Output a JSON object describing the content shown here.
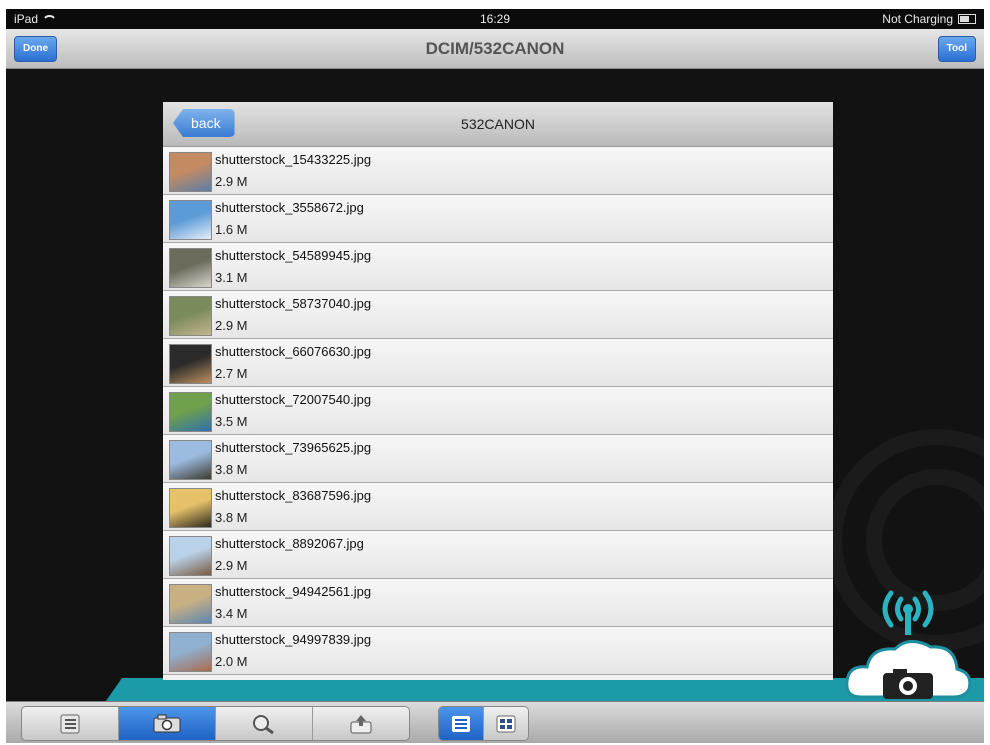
{
  "status_bar": {
    "device": "iPad",
    "time": "16:29",
    "battery_text": "Not Charging"
  },
  "nav_bar": {
    "title": "DCIM/532CANON",
    "left_button": "Done",
    "right_button": "Tool"
  },
  "panel": {
    "back_label": "back",
    "title": "532CANON"
  },
  "files": [
    {
      "name": "shutterstock_15433225.jpg",
      "size": "2.9 M"
    },
    {
      "name": "shutterstock_3558672.jpg",
      "size": "1.6 M"
    },
    {
      "name": "shutterstock_54589945.jpg",
      "size": "3.1 M"
    },
    {
      "name": "shutterstock_58737040.jpg",
      "size": "2.9 M"
    },
    {
      "name": "shutterstock_66076630.jpg",
      "size": "2.7 M"
    },
    {
      "name": "shutterstock_72007540.jpg",
      "size": "3.5 M"
    },
    {
      "name": "shutterstock_73965625.jpg",
      "size": "3.8 M"
    },
    {
      "name": "shutterstock_83687596.jpg",
      "size": "3.8 M"
    },
    {
      "name": "shutterstock_8892067.jpg",
      "size": "2.9 M"
    },
    {
      "name": "shutterstock_94942561.jpg",
      "size": "3.4 M"
    },
    {
      "name": "shutterstock_94997839.jpg",
      "size": "2.0 M"
    }
  ],
  "toolbar": {
    "tabs": [
      "list-icon",
      "camera-icon",
      "search-icon",
      "share-icon"
    ],
    "selected_tab": 1,
    "view_modes": [
      "list-view-icon",
      "grid-view-icon"
    ],
    "selected_view": 0
  },
  "colors": {
    "accent": "#2a6fd4",
    "teal": "#1d9aa7",
    "background": "#121212"
  }
}
